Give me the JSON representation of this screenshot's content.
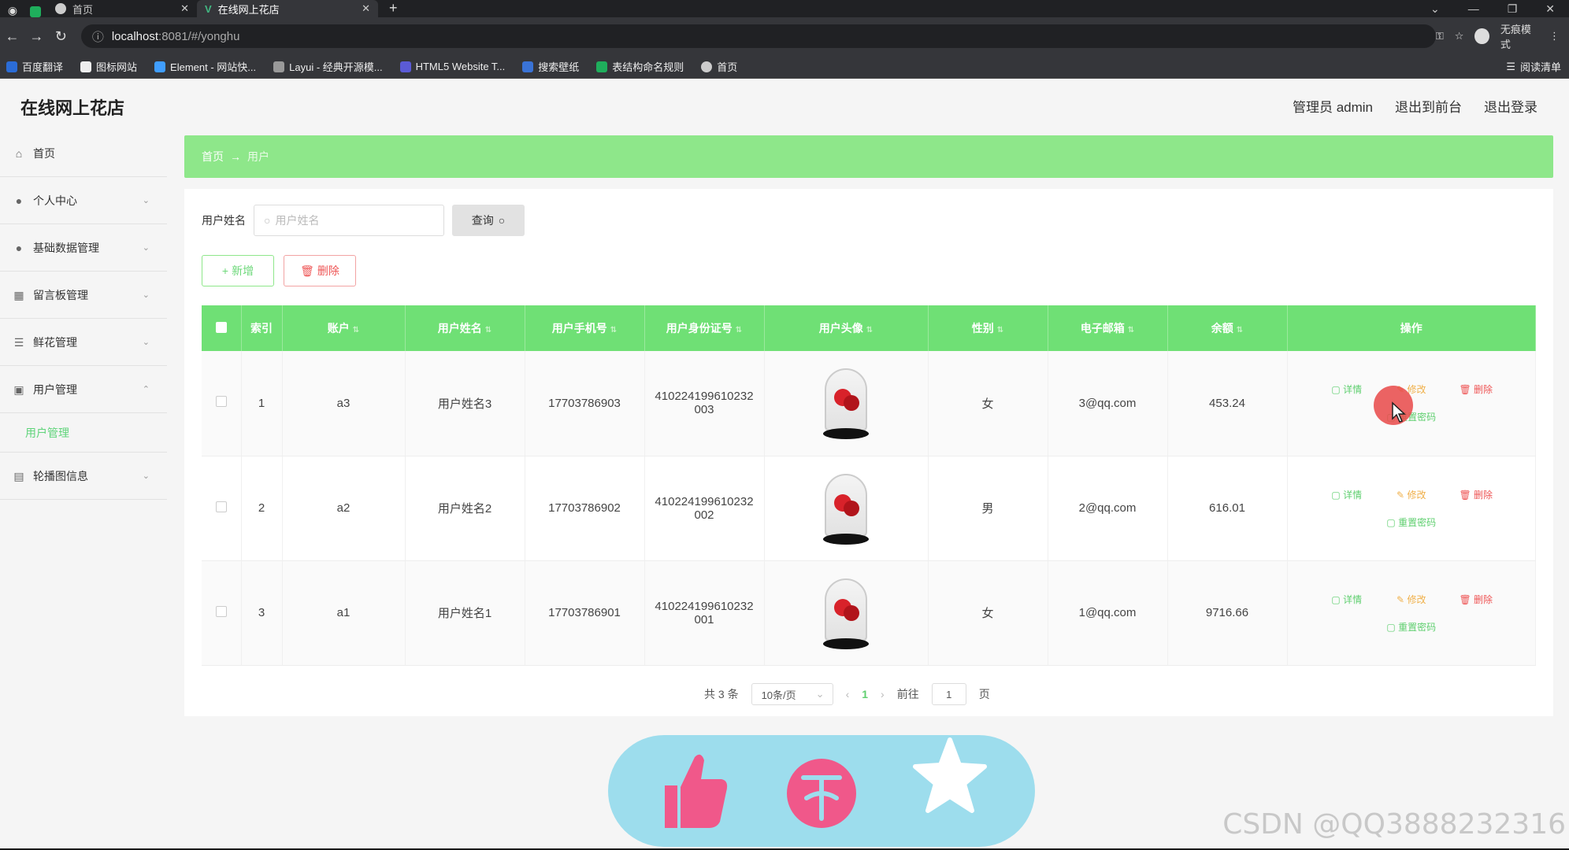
{
  "browser": {
    "tabs": [
      {
        "title": "首页"
      },
      {
        "title": "在线网上花店"
      }
    ],
    "url_host": "localhost",
    "url_path": ":8081/#/yonghu",
    "incognito_label": "无痕模式",
    "bookmarks": [
      "百度翻译",
      "图标网站",
      "Element - 网站快...",
      "Layui - 经典开源模...",
      "HTML5 Website T...",
      "搜索壁纸",
      "表结构命名规则",
      "首页"
    ],
    "reading_list": "阅读清单"
  },
  "header": {
    "title": "在线网上花店",
    "admin_label": "管理员 admin",
    "back_front": "退出到前台",
    "logout": "退出登录"
  },
  "sidebar": {
    "items": [
      {
        "label": "首页",
        "icon": "home-icon"
      },
      {
        "label": "个人中心",
        "icon": "user-icon"
      },
      {
        "label": "基础数据管理",
        "icon": "user-icon"
      },
      {
        "label": "留言板管理",
        "icon": "message-icon"
      },
      {
        "label": "鲜花管理",
        "icon": "list-icon"
      },
      {
        "label": "用户管理",
        "icon": "briefcase-icon"
      },
      {
        "label": "轮播图信息",
        "icon": "image-icon"
      }
    ],
    "sub_item": "用户管理"
  },
  "breadcrumb": {
    "home": "首页",
    "sep": "→",
    "current": "用户"
  },
  "search": {
    "label": "用户姓名",
    "placeholder": "用户姓名",
    "button": "查询"
  },
  "actions": {
    "add": "新增",
    "delete": "删除"
  },
  "table": {
    "columns": [
      "索引",
      "账户",
      "用户姓名",
      "用户手机号",
      "用户身份证号",
      "用户头像",
      "性别",
      "电子邮箱",
      "余额",
      "操作"
    ],
    "rows": [
      {
        "index": "1",
        "account": "a3",
        "name": "用户姓名3",
        "phone": "17703786903",
        "id_line1": "410224199610232",
        "id_line2": "003",
        "gender": "女",
        "email": "3@qq.com",
        "balance": "453.24"
      },
      {
        "index": "2",
        "account": "a2",
        "name": "用户姓名2",
        "phone": "17703786902",
        "id_line1": "410224199610232",
        "id_line2": "002",
        "gender": "男",
        "email": "2@qq.com",
        "balance": "616.01"
      },
      {
        "index": "3",
        "account": "a1",
        "name": "用户姓名1",
        "phone": "17703786901",
        "id_line1": "410224199610232",
        "id_line2": "001",
        "gender": "女",
        "email": "1@qq.com",
        "balance": "9716.66"
      }
    ],
    "ops": {
      "detail": "详情",
      "edit": "修改",
      "delete": "删除",
      "reset": "重置密码"
    }
  },
  "pagination": {
    "total": "共 3 条",
    "page_size": "10条/页",
    "current": "1",
    "goto_label": "前往",
    "goto_value": "1",
    "page_unit": "页"
  },
  "watermark": "CSDN @QQ3888232316",
  "colors": {
    "accent": "#6fe075",
    "breadcrumb": "#8ee78a",
    "danger": "#ee5555",
    "fab_bg": "#9ddded",
    "fab_pink": "#f0588a"
  }
}
